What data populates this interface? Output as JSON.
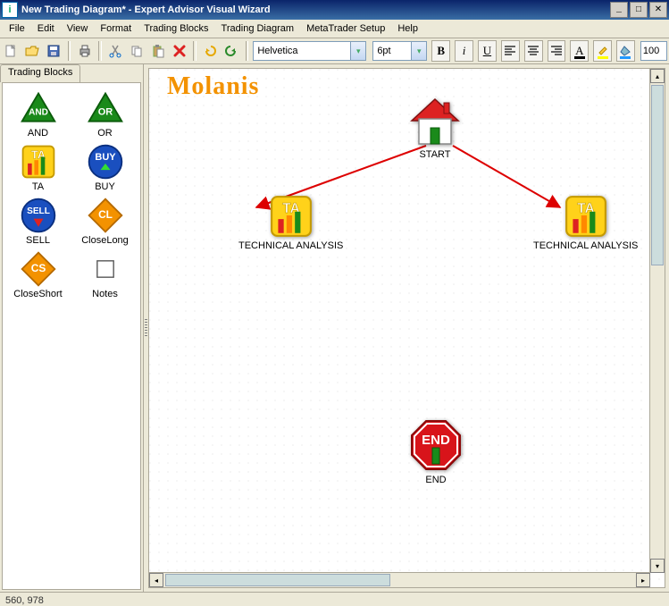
{
  "title": "New Trading Diagram* - Expert Advisor Visual Wizard",
  "menu": [
    "File",
    "Edit",
    "View",
    "Format",
    "Trading Blocks",
    "Trading Diagram",
    "MetaTrader Setup",
    "Help"
  ],
  "toolbar": {
    "font": "Helvetica",
    "font_size": "6pt",
    "zoom": "100"
  },
  "palette": {
    "tab": "Trading Blocks",
    "items": [
      {
        "key": "and",
        "label": "AND"
      },
      {
        "key": "or",
        "label": "OR"
      },
      {
        "key": "ta",
        "label": "TA"
      },
      {
        "key": "buy",
        "label": "BUY"
      },
      {
        "key": "sell",
        "label": "SELL"
      },
      {
        "key": "closelong",
        "label": "CloseLong"
      },
      {
        "key": "closeshort",
        "label": "CloseShort"
      },
      {
        "key": "notes",
        "label": "Notes"
      }
    ]
  },
  "brand": "Molanis",
  "canvas": {
    "start": {
      "label": "START"
    },
    "ta1": {
      "label": "TECHNICAL ANALYSIS"
    },
    "ta2": {
      "label": "TECHNICAL ANALYSIS"
    },
    "end": {
      "label": "END"
    }
  },
  "status": "560, 978"
}
